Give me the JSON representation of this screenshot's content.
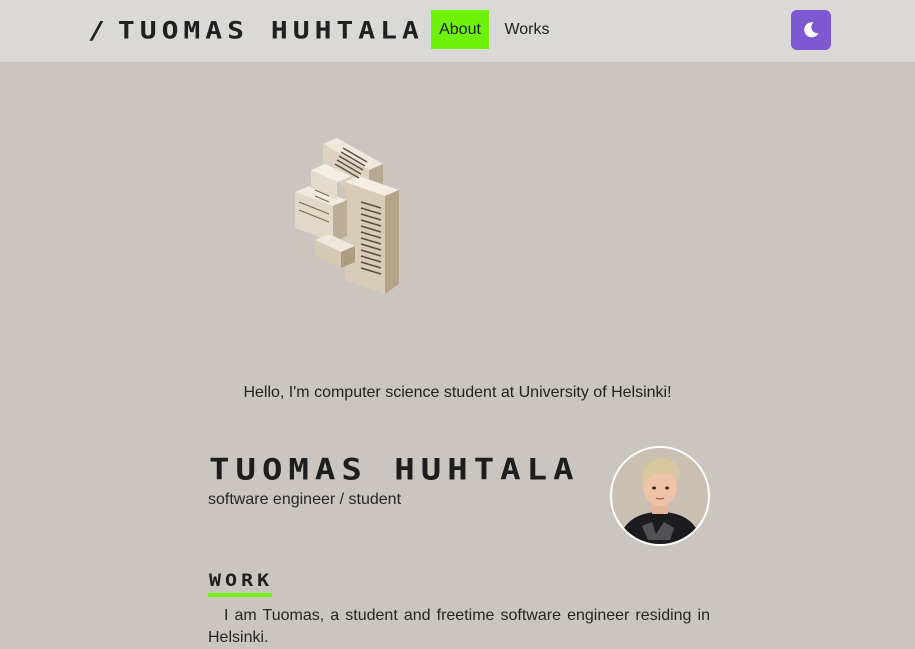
{
  "navbar": {
    "brand_slash": "/",
    "brand_name": "TUOMAS HUHTALA",
    "links": [
      {
        "label": "About",
        "active": true
      },
      {
        "label": "Works",
        "active": false
      }
    ],
    "theme_toggle_icon": "moon-icon"
  },
  "hero": {
    "model": "voxel-building-model",
    "intro": "Hello, I'm computer science student at University of Helsinki!"
  },
  "profile": {
    "name": "TUOMAS HUHTALA",
    "role": "software engineer / student",
    "avatar": "profile-photo"
  },
  "work": {
    "title": "WORK",
    "text": "I am Tuomas, a student and freetime software engineer residing in Helsinki."
  },
  "colors": {
    "background": "#cac6bf",
    "navbar": "#dbd9d5",
    "accent_green": "#6ef20a",
    "accent_purple": "#7e57d2"
  }
}
